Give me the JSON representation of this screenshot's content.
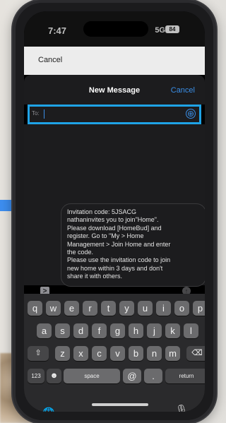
{
  "status_bar": {
    "time": "7:47",
    "network": "5G",
    "battery": "84"
  },
  "sheet_top": {
    "cancel_label": "Cancel"
  },
  "nav": {
    "title": "New Message",
    "cancel_label": "Cancel"
  },
  "to_field": {
    "label": "To:",
    "value": ""
  },
  "message": {
    "text": "Invitation code: 5JSACG\nnathaninvites you to join\"Home\".\nPlease download [HomeBud] and\nregister. Go to \"My > Home\nManagement > Join Home and enter\nthe code.\nPlease use the invitation code to join\nnew home within 3 days and don't\nshare it with others."
  },
  "keyboard": {
    "row1": [
      "q",
      "w",
      "e",
      "r",
      "t",
      "y",
      "u",
      "i",
      "o",
      "p"
    ],
    "row2": [
      "a",
      "s",
      "d",
      "f",
      "g",
      "h",
      "j",
      "k",
      "l"
    ],
    "row3": [
      "z",
      "x",
      "c",
      "v",
      "b",
      "n",
      "m"
    ],
    "shift_glyph": "⇧",
    "delete_glyph": "⌫",
    "num_label": "123",
    "emoji_glyph": "☻",
    "space_label": "space",
    "at_label": "@",
    "dot_label": ".",
    "return_label": "return",
    "globe_glyph": "🌐",
    "mic_glyph": "🎙"
  },
  "icons": {
    "add": "⊕",
    "apps": ">",
    "send": "↑"
  },
  "colors": {
    "accent": "#3a8ee6",
    "highlight_border": "#1fa3e6"
  }
}
